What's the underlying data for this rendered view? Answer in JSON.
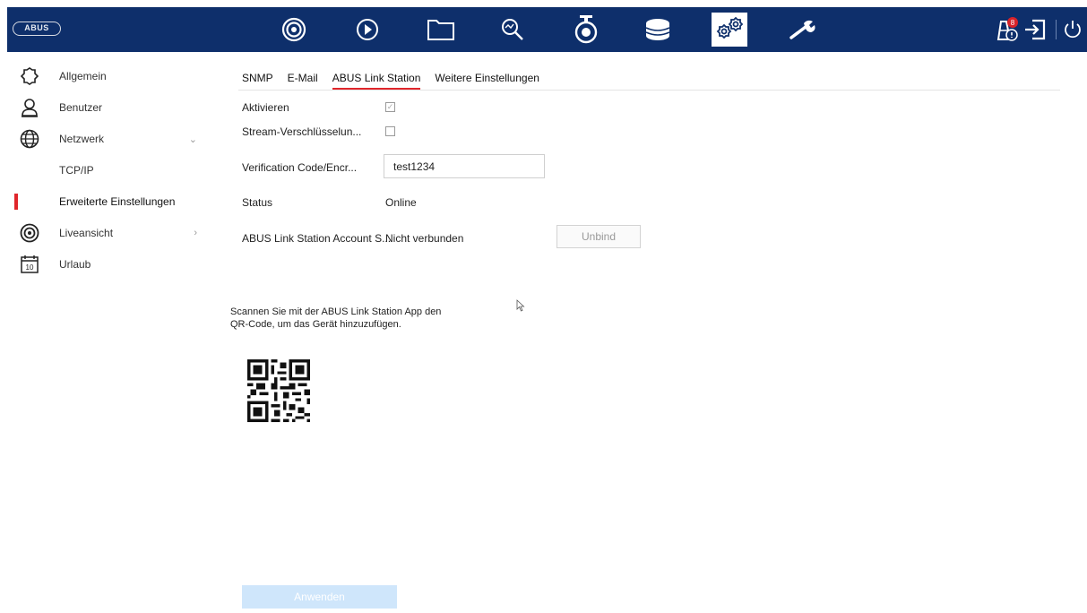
{
  "brand": "ABUS",
  "topnav": [
    {
      "icon": "live-view-icon"
    },
    {
      "icon": "playback-icon"
    },
    {
      "icon": "file-management-icon"
    },
    {
      "icon": "search-icon"
    },
    {
      "icon": "camera-icon"
    },
    {
      "icon": "storage-icon"
    },
    {
      "icon": "configuration-icon",
      "active": true
    },
    {
      "icon": "maintenance-icon"
    }
  ],
  "topright": {
    "alarm_badge": "8"
  },
  "sidebar": {
    "items": [
      {
        "label": "Allgemein",
        "icon": "gear-icon"
      },
      {
        "label": "Benutzer",
        "icon": "user-icon"
      },
      {
        "label": "Netzwerk",
        "icon": "globe-icon"
      },
      {
        "label": "TCP/IP"
      },
      {
        "label": "Erweiterte Einstellungen"
      },
      {
        "label": "Liveansicht",
        "icon": "live-view-icon"
      },
      {
        "label": "Urlaub",
        "icon": "calendar-icon",
        "icon_text": "10"
      }
    ]
  },
  "tabs": [
    "SNMP",
    "E-Mail",
    "ABUS Link Station",
    "Weitere Einstellungen"
  ],
  "form": {
    "enable_label": "Aktivieren",
    "enable_checked": true,
    "stream_encrypt_label": "Stream-Verschlüsselun...",
    "stream_encrypt_checked": false,
    "verification_label": "Verification Code/Encr...",
    "verification_value": "test1234",
    "status_label": "Status",
    "status_value": "Online",
    "account_label": "ABUS Link Station Account S...",
    "account_value": "Nicht verbunden",
    "unbind_label": "Unbind"
  },
  "scan_text_line1": "Scannen Sie mit der ABUS Link Station App den",
  "scan_text_line2": "QR-Code, um das Gerät hinzuzufügen.",
  "apply_label": "Anwenden",
  "colors": {
    "topbar": "#0e2f6b",
    "accent": "#e0262b",
    "apply": "#cfe6fb"
  }
}
